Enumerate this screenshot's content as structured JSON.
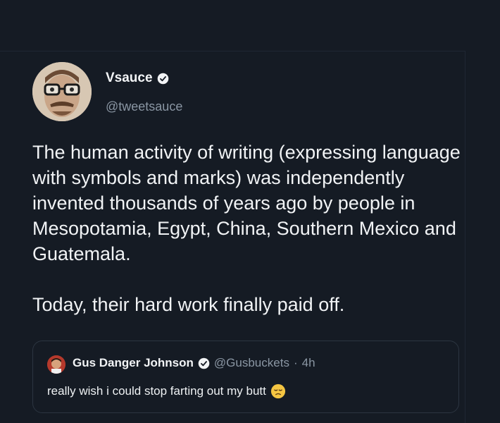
{
  "tweet": {
    "display_name": "Vsauce",
    "handle": "@tweetsauce",
    "verified_icon": "verified-badge-icon",
    "text_paragraphs": [
      "The human activity of writing (expressing language with symbols and marks) was independently invented thousands of years ago by people in Mesopotamia, Egypt, China, Southern Mexico and Guatemala.",
      "Today, their hard work finally paid off."
    ]
  },
  "quoted_tweet": {
    "display_name": "Gus Danger Johnson",
    "handle": "@Gusbuckets",
    "separator": "·",
    "time": "4h",
    "text": "really wish i could stop farting out my butt",
    "emoji": "disappointed-face-icon"
  },
  "colors": {
    "background": "#151b24",
    "text": "#f1f3f5",
    "muted": "#8a96a3",
    "border": "#2c3541"
  }
}
